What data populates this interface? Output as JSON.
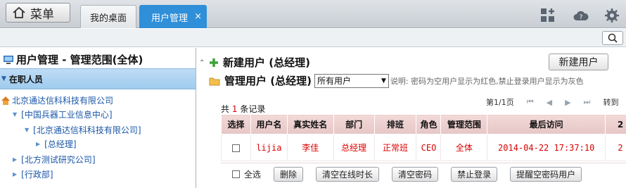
{
  "topbar": {
    "menu_label": "菜单",
    "tabs": [
      {
        "label": "我的桌面",
        "active": false
      },
      {
        "label": "用户管理",
        "active": true,
        "close": "×"
      }
    ],
    "accent_color": "#2f8fd8"
  },
  "left_panel": {
    "title": "用户管理 - 管理范围(全体)",
    "section_label": "在职人员",
    "tree": [
      {
        "label": "北京通达信科科技有限公司",
        "level": 0,
        "icon": "home-icon"
      },
      {
        "label": "[中国兵器工业信息中心]",
        "level": 1
      },
      {
        "label": "[北京通达信科科技有限公司]",
        "level": 2
      },
      {
        "label": "[总经理]",
        "level": 3
      },
      {
        "label": "[北方测试研究公司]",
        "level": 1
      },
      {
        "label": "[行政部]",
        "level": 1
      }
    ]
  },
  "main": {
    "new_user_heading": "新建用户 (总经理)",
    "new_user_button": "新建用户",
    "manage_heading": "管理用户 (总经理)",
    "filter_selected": "所有用户",
    "hint": "说明: 密码为空用户显示为红色,禁止登录用户显示为灰色",
    "pager": {
      "page_text": "第1/1页",
      "goto_label": "转到"
    },
    "count": {
      "prefix": "共",
      "value": "1",
      "suffix": "条记录"
    },
    "table": {
      "columns": [
        "选择",
        "用户名",
        "真实姓名",
        "部门",
        "排班",
        "角色",
        "管理范围",
        "最后访问",
        "2"
      ],
      "rows": [
        {
          "username": "lijia",
          "real_name": "李佳",
          "department": "总经理",
          "shift": "正常班",
          "role": "CEO",
          "scope": "全体",
          "last_visit": "2014-04-22 17:37:10",
          "extra": "2"
        }
      ]
    },
    "bottom": {
      "select_all_label": "全选",
      "buttons": [
        "删除",
        "清空在线时长",
        "清空密码",
        "禁止登录",
        "提醒空密码用户"
      ]
    }
  }
}
